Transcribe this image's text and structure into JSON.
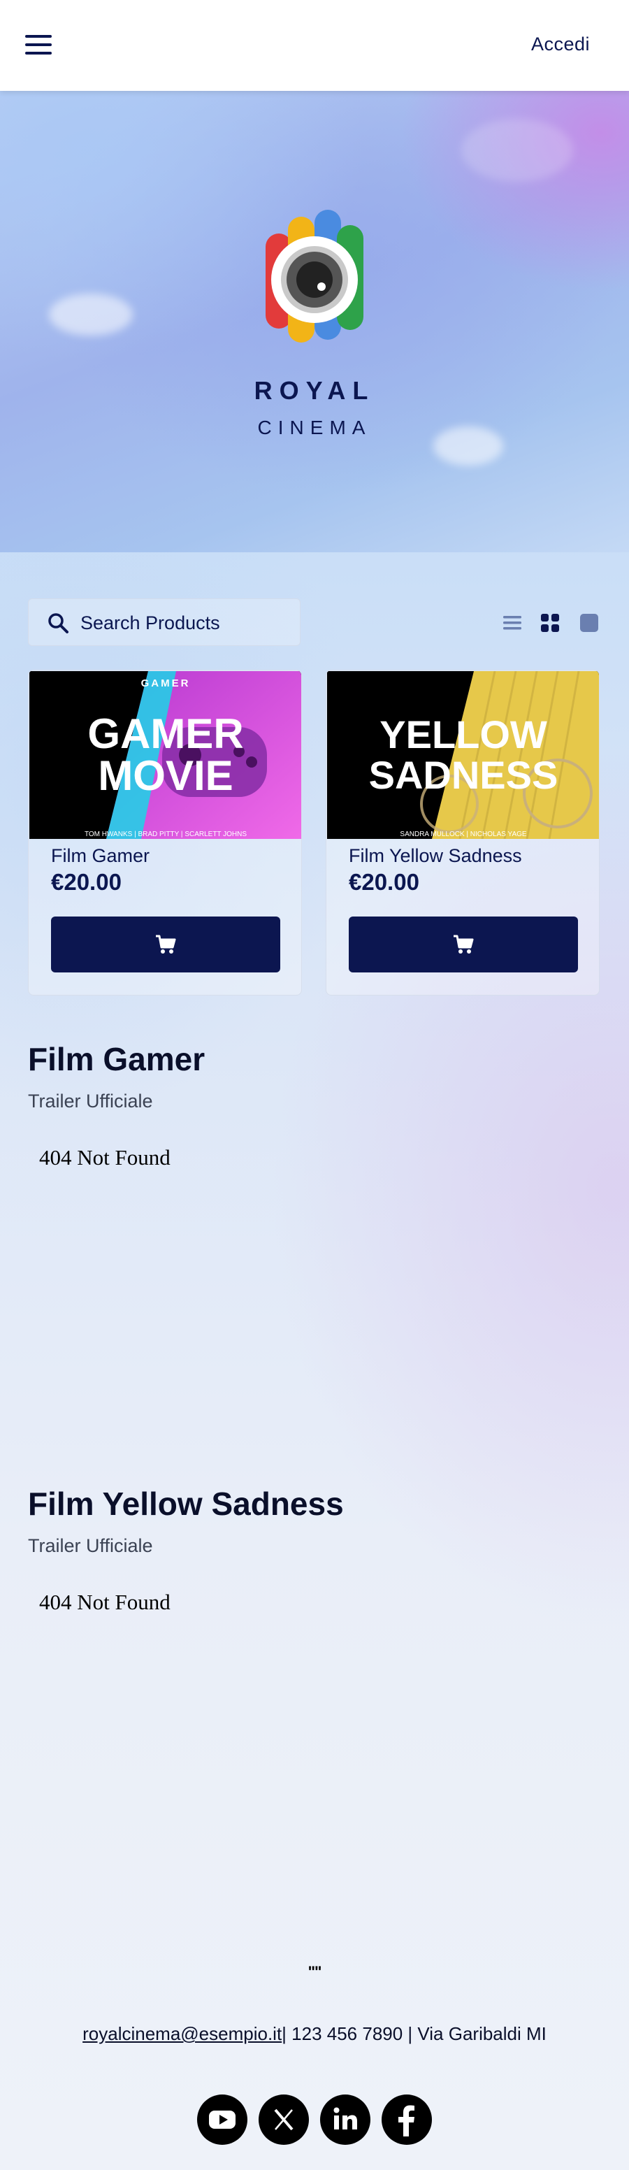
{
  "header": {
    "menu_icon": "hamburger-icon",
    "login_label": "Accedi"
  },
  "hero": {
    "brand_line1": "ROYAL",
    "brand_line2": "CINEMA",
    "logo_icon": "camera-lens-logo"
  },
  "shop": {
    "search_placeholder": "Search Products",
    "view_modes": [
      "list-view-icon",
      "grid-view-icon",
      "single-view-icon"
    ],
    "active_view": "grid-view-icon",
    "products": [
      {
        "name": "Film Gamer",
        "price": "€20.00",
        "poster": {
          "top_label": "GAMER",
          "headline_1": "GAMER",
          "headline_2": "MOVIE",
          "credits": "TOM HWANKS  |  BRAD PITTY  |  SCARLETT JOHNS"
        }
      },
      {
        "name": "Film Yellow Sadness",
        "price": "€20.00",
        "poster": {
          "headline_1": "YELLOW",
          "headline_2": "SADNESS",
          "credits": "SANDRA MULLOCK  |  NICHOLAS YAGE"
        }
      }
    ]
  },
  "trailers": [
    {
      "title": "Film Gamer",
      "subtitle": "Trailer Ufficiale",
      "embed_text": "404 Not Found"
    },
    {
      "title": "Film Yellow Sadness",
      "subtitle": "Trailer Ufficiale",
      "embed_text": "404 Not Found"
    }
  ],
  "footer": {
    "dots": "\"\"",
    "email": "royalcinema@esempio.it",
    "rest": "| 123 456 7890 | Via Garibaldi MI",
    "social": [
      "youtube-icon",
      "x-icon",
      "linkedin-icon",
      "facebook-icon"
    ]
  },
  "colors": {
    "navy": "#0c1650",
    "accent_purple": "#c48ce8",
    "poster_magenta": "#d850e0",
    "poster_yellow": "#e8c84a"
  }
}
